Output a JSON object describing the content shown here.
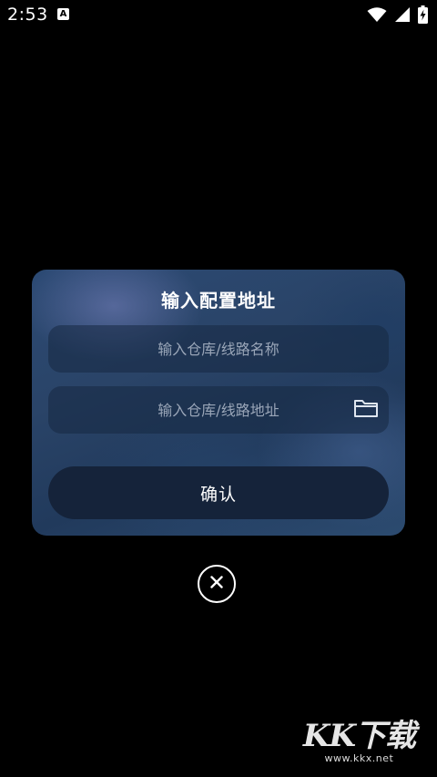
{
  "status_bar": {
    "time": "2:53",
    "notification_icon": "A"
  },
  "dialog": {
    "title": "输入配置地址",
    "name_field": {
      "value": "",
      "placeholder": "输入仓库/线路名称"
    },
    "url_field": {
      "value": "",
      "placeholder": "输入仓库/线路地址"
    },
    "confirm_label": "确认"
  },
  "watermark": {
    "logo": "KK下载",
    "url": "www.kkx.net"
  },
  "colors": {
    "background": "#000000",
    "dialog_bg": "#2a4468",
    "confirm_bg": "#15233a",
    "placeholder": "#9aa6b8"
  }
}
